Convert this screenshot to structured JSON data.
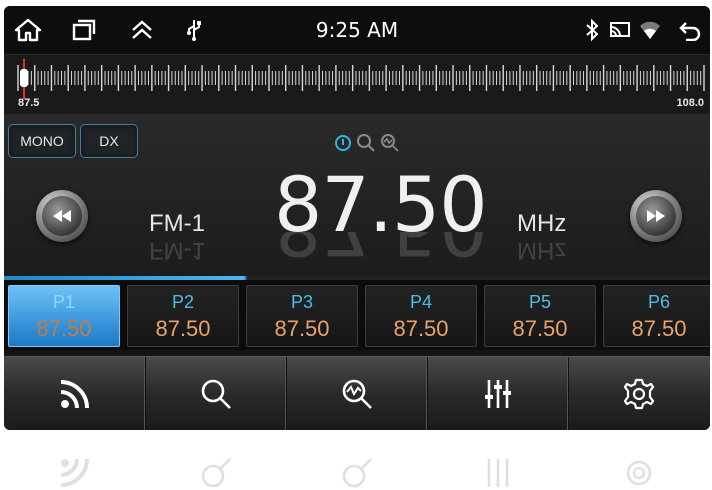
{
  "status_bar": {
    "time": "9:25 AM",
    "left_icons": [
      "home-icon",
      "recent-apps-icon",
      "chevron-up-icon",
      "usb-icon"
    ],
    "right_icons": [
      "bluetooth-icon",
      "cast-icon",
      "wifi-icon",
      "back-icon"
    ]
  },
  "tuner": {
    "min_label": "87.5",
    "max_label": "108.0",
    "position": 0.0
  },
  "mode_buttons": [
    {
      "label": "MONO"
    },
    {
      "label": "DX"
    }
  ],
  "mode_icons": [
    "info-icon",
    "search-icon",
    "scan-icon"
  ],
  "display": {
    "band": "FM-1",
    "frequency": "87.50",
    "unit": "MHz"
  },
  "presets": [
    {
      "name": "P1",
      "freq": "87.50",
      "active": true
    },
    {
      "name": "P2",
      "freq": "87.50",
      "active": false
    },
    {
      "name": "P3",
      "freq": "87.50",
      "active": false
    },
    {
      "name": "P4",
      "freq": "87.50",
      "active": false
    },
    {
      "name": "P5",
      "freq": "87.50",
      "active": false
    },
    {
      "name": "P6",
      "freq": "87.50",
      "active": false
    }
  ],
  "toolbar": [
    "radio-signal-icon",
    "search-icon",
    "scan-icon",
    "equalizer-icon",
    "gear-icon"
  ],
  "colors": {
    "accent": "#1e88c9",
    "preset_name": "#4dbde6",
    "preset_freq": "#e9a36a",
    "needle": "#e53030"
  }
}
